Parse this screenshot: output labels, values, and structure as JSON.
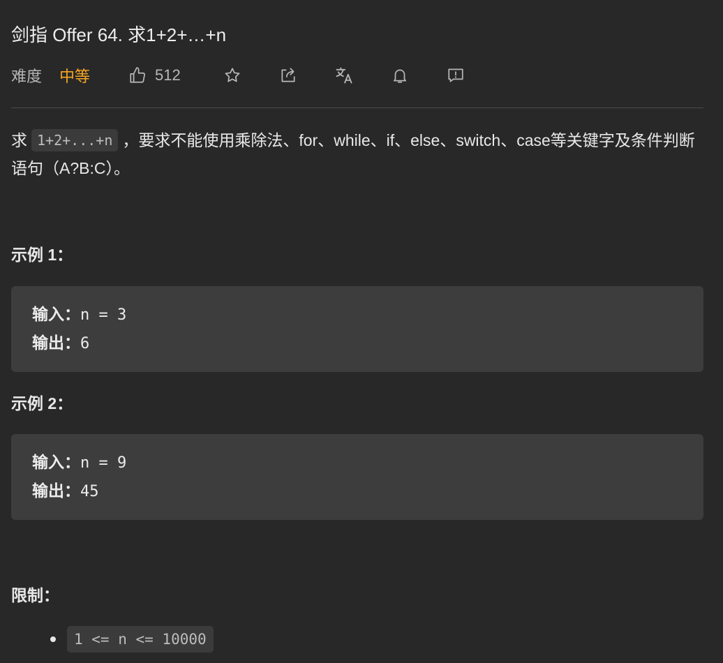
{
  "problem": {
    "title": "剑指 Offer 64. 求1+2+…+n",
    "difficulty_label": "难度",
    "difficulty": "中等",
    "likes": "512"
  },
  "toolbar": {
    "icons": [
      "thumbs-up-icon",
      "star-icon",
      "share-icon",
      "translate-icon",
      "bell-icon",
      "feedback-icon"
    ]
  },
  "description": {
    "prefix": "求",
    "code": "1+2+...+n",
    "suffix": "，要求不能使用乘除法、for、while、if、else、switch、case等关键字及条件判断语句（A?B:C）。"
  },
  "examples": [
    {
      "heading": "示例 1：",
      "input_label": "输入：",
      "input_value": "n = 3",
      "output_label": "输出：",
      "output_value": "6"
    },
    {
      "heading": "示例 2：",
      "input_label": "输入：",
      "input_value": "n = 9",
      "output_label": "输出：",
      "output_value": "45"
    }
  ],
  "constraints": {
    "heading": "限制：",
    "items": [
      "1 <= n <= 10000"
    ]
  },
  "colors": {
    "background": "#282828",
    "difficulty_medium": "#f5a623",
    "code_background": "#3d3d3d"
  }
}
